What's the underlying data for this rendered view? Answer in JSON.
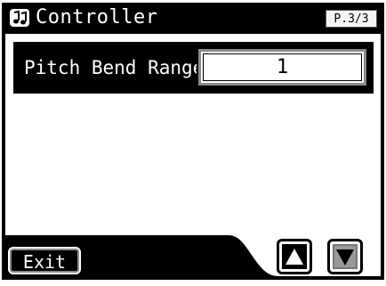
{
  "title": "Controller",
  "title_icon": "music-notes-icon",
  "page_indicator": "P.3/3",
  "parameter": {
    "label": "Pitch Bend Range",
    "value": "1"
  },
  "buttons": {
    "exit_label": "Exit",
    "up_icon": "arrow-up-icon",
    "down_icon": "arrow-down-icon"
  },
  "colors": {
    "background": "#ffffff",
    "bar": "#000000",
    "border_gray": "#8a8a8a"
  }
}
